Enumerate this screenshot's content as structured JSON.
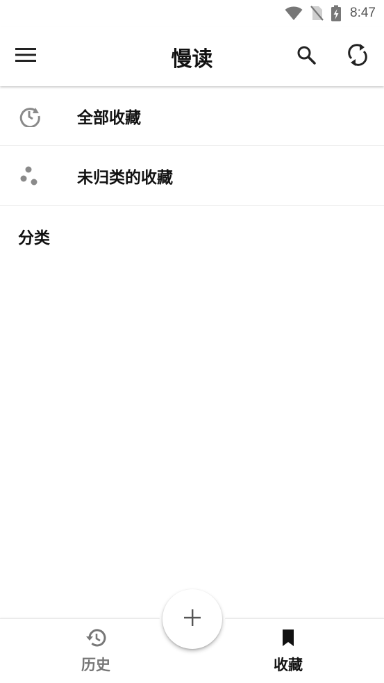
{
  "status_bar": {
    "time": "8:47",
    "icons": [
      "wifi-icon",
      "no-sim-icon",
      "battery-charging-icon"
    ]
  },
  "app_bar": {
    "title": "慢读",
    "icons": [
      "menu-icon",
      "search-icon",
      "sync-icon"
    ]
  },
  "list": {
    "items": [
      {
        "label": "全部收藏",
        "icon": "history-circle-icon"
      },
      {
        "label": "未归类的收藏",
        "icon": "scatter-dots-icon"
      }
    ],
    "section_header": "分类"
  },
  "bottom_nav": {
    "tabs": [
      {
        "label": "历史",
        "icon": "history-icon",
        "active": false
      },
      {
        "label": "收藏",
        "icon": "bookmark-icon",
        "active": true
      }
    ],
    "fab_icon": "add-icon"
  },
  "colors": {
    "text_primary": "#111111",
    "text_inactive": "#777777",
    "icon_gray": "#888888",
    "divider": "#eeeeee",
    "background": "#ffffff"
  }
}
